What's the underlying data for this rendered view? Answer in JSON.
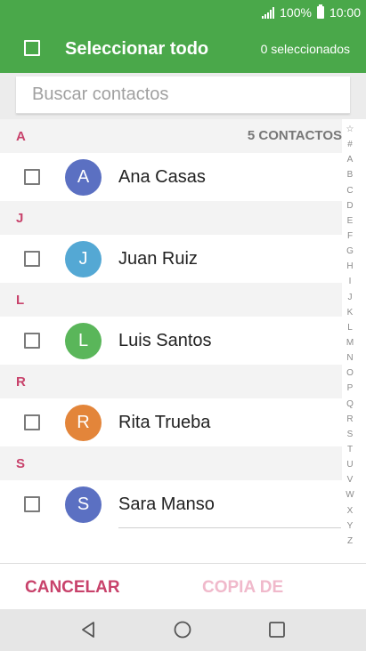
{
  "status_bar": {
    "battery": "100%",
    "time": "10:00"
  },
  "header": {
    "title": "Seleccionar todo",
    "selected_count": "0 seleccionados"
  },
  "search": {
    "placeholder": "Buscar contactos"
  },
  "list": {
    "contact_count": "5 CONTACTOS",
    "sections": [
      {
        "letter": "A",
        "contact": {
          "initial": "A",
          "name": "Ana Casas",
          "color": "#5b70c2"
        }
      },
      {
        "letter": "J",
        "contact": {
          "initial": "J",
          "name": "Juan Ruiz",
          "color": "#54a8d4"
        }
      },
      {
        "letter": "L",
        "contact": {
          "initial": "L",
          "name": "Luis Santos",
          "color": "#5ab65a"
        }
      },
      {
        "letter": "R",
        "contact": {
          "initial": "R",
          "name": "Rita Trueba",
          "color": "#e3853a"
        }
      },
      {
        "letter": "S",
        "contact": {
          "initial": "S",
          "name": "Sara Manso",
          "color": "#5b70c2"
        }
      }
    ]
  },
  "index_bar": [
    "☆",
    "#",
    "A",
    "B",
    "C",
    "D",
    "E",
    "F",
    "G",
    "H",
    "I",
    "J",
    "K",
    "L",
    "M",
    "N",
    "O",
    "P",
    "Q",
    "R",
    "S",
    "T",
    "U",
    "V",
    "W",
    "X",
    "Y",
    "Z"
  ],
  "actions": {
    "cancel": "CANCELAR",
    "copy": "COPIA DE"
  },
  "colors": {
    "header": "#4aa84a",
    "accent": "#c8426b",
    "disabled": "#f0b9cb"
  }
}
